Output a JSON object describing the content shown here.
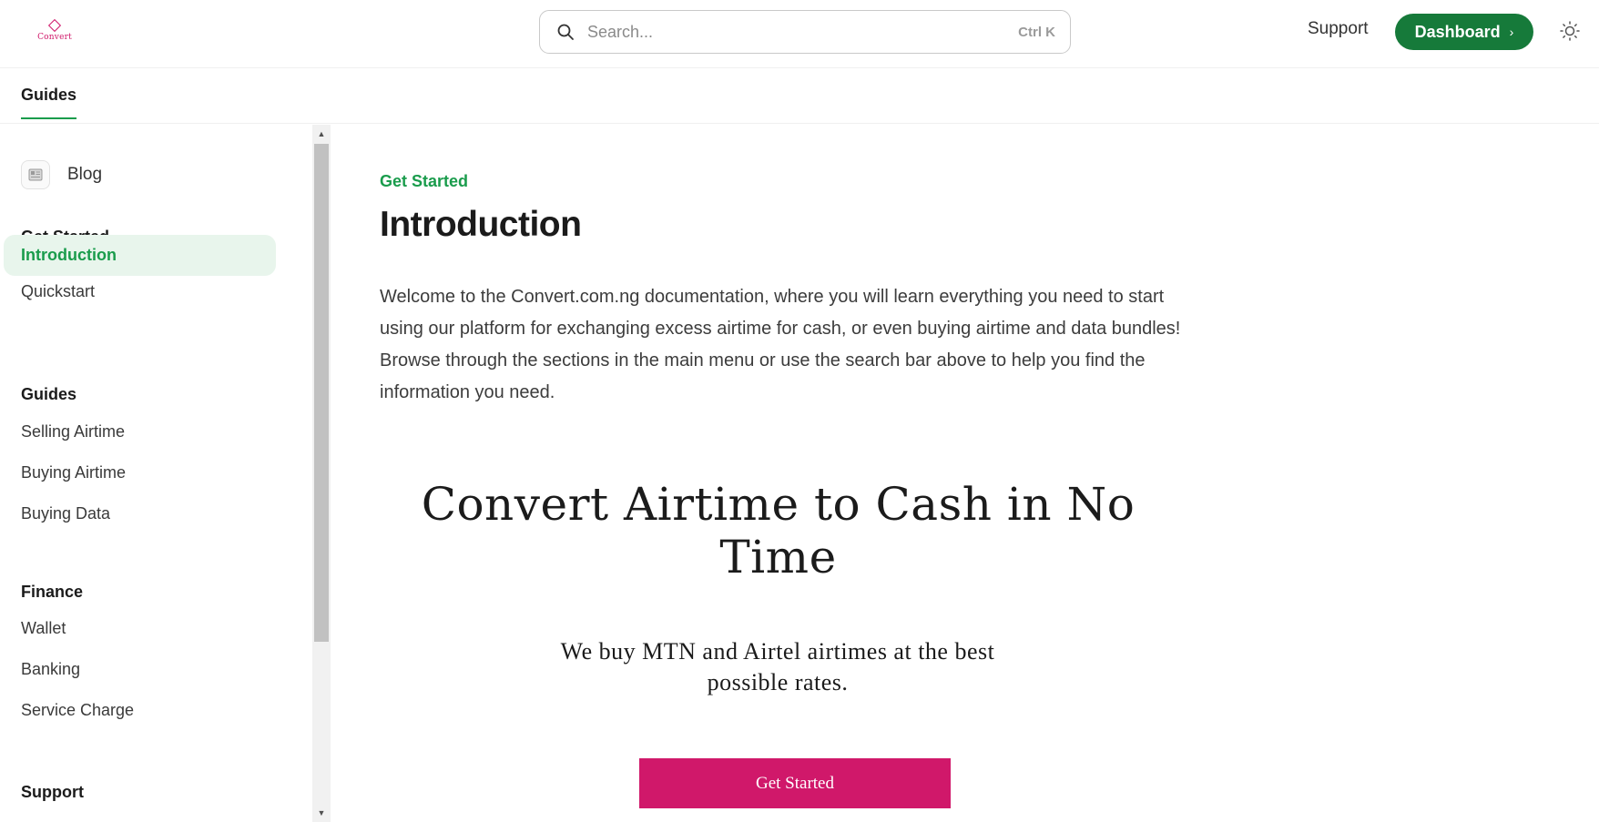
{
  "header": {
    "logo_text": "Convert",
    "search_placeholder": "Search...",
    "search_shortcut": "Ctrl K",
    "support_label": "Support",
    "dashboard_label": "Dashboard",
    "icons": {
      "search": "search-icon",
      "dashboard": "chevron-right-icon",
      "theme": "sun-icon"
    }
  },
  "tabs": [
    {
      "label": "Guides",
      "active": true
    }
  ],
  "sidebar": {
    "blog_label": "Blog",
    "blog_icon": "newspaper-icon",
    "sections": [
      {
        "title": "Get Started",
        "items": [
          {
            "label": "Introduction",
            "active": true
          },
          {
            "label": "Quickstart"
          }
        ]
      },
      {
        "title": "Guides",
        "items": [
          {
            "label": "Selling Airtime"
          },
          {
            "label": "Buying Airtime"
          },
          {
            "label": "Buying Data"
          }
        ]
      },
      {
        "title": "Finance",
        "items": [
          {
            "label": "Wallet"
          },
          {
            "label": "Banking"
          },
          {
            "label": "Service Charge"
          }
        ]
      },
      {
        "title": "Support",
        "items": []
      }
    ]
  },
  "main": {
    "eyebrow": "Get Started",
    "title": "Introduction",
    "intro": "Welcome to the Convert.com.ng documentation, where you will learn everything you need to start using our platform for exchanging excess airtime for cash, or even buying airtime and data bundles! Browse through the sections in the main menu or use the search bar above to help you find the information you need.",
    "hero": {
      "title": "Convert Airtime to Cash in No Time",
      "subtitle": "We buy MTN and Airtel airtimes at the best possible rates.",
      "button_label": "Get Started"
    }
  },
  "colors": {
    "accent_green": "#1a9c4c",
    "dashboard_button": "#167a3a",
    "active_nav_bg": "#e8f5ec",
    "brand_pink": "#d0186a"
  }
}
